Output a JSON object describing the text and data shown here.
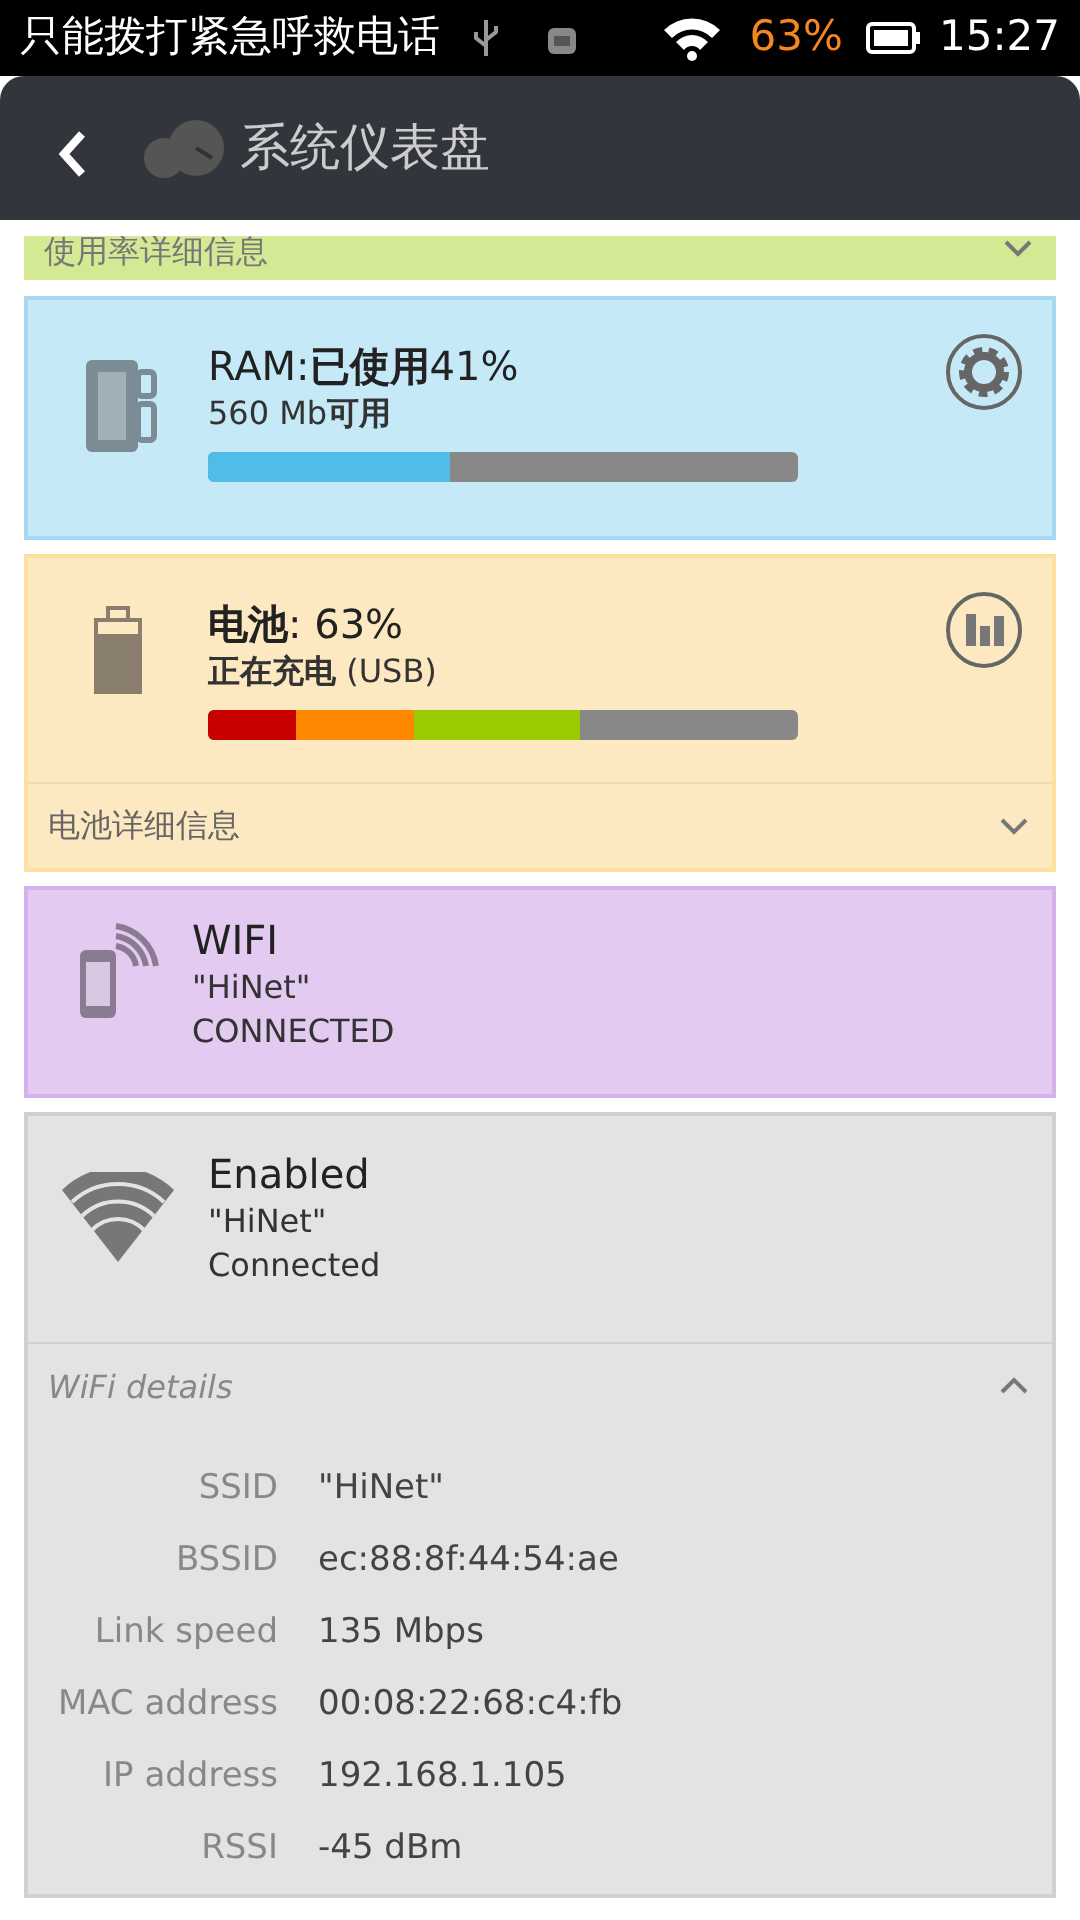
{
  "status_bar": {
    "notice": "只能拨打紧急呼救电话",
    "battery": "63%",
    "time": "15:27"
  },
  "app_bar": {
    "title": "系统仪表盘"
  },
  "usage_details": {
    "label": "使用率详细信息",
    "expanded": false
  },
  "ram": {
    "title": "RAM:**已使用**41%",
    "subtitle": "560 Mb**可用**",
    "level": 0.41
  },
  "battery": {
    "title": "**电池**: 63%",
    "subtitle": "**正在充电** (USB)",
    "level": 0.63,
    "details": {
      "label": "电池详细信息",
      "expanded": false
    }
  },
  "wifi": {
    "title": "WIFI",
    "network": "\"HiNet\"",
    "state": "CONNECTED"
  },
  "wifi_status": {
    "title": "Enabled",
    "network": "\"HiNet\"",
    "state": "Connected",
    "details": {
      "label": "WiFi details",
      "expanded": true,
      "rows": [
        {
          "label": "SSID",
          "value": "\"HiNet\""
        },
        {
          "label": "BSSID",
          "value": "ec:88:8f:44:54:ae"
        },
        {
          "label": "Link speed",
          "value": "135 Mbps"
        },
        {
          "label": "MAC address",
          "value": "00:08:22:68:c4:fb"
        },
        {
          "label": "IP address",
          "value": "192.168.1.105"
        },
        {
          "label": "RSSI",
          "value": "-45 dBm"
        }
      ]
    }
  }
}
